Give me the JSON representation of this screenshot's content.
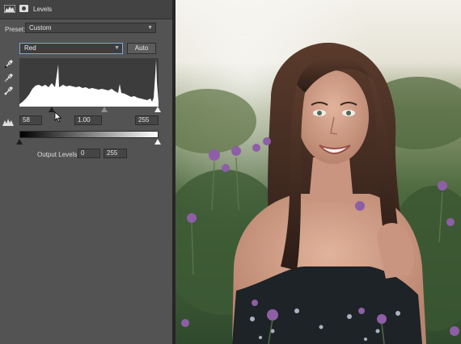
{
  "panel": {
    "title": "Levels",
    "preset_label": "Preset:",
    "preset_value": "Custom",
    "channel_value": "Red",
    "auto_label": "Auto",
    "input_levels": {
      "black": "58",
      "gamma": "1.00",
      "white": "255"
    },
    "output_label": "Output Levels:",
    "output_levels": {
      "black": "0",
      "white": "255"
    },
    "icons": [
      "levels-adjustment-icon",
      "layer-mask-icon",
      "black-point-eyedropper-icon",
      "gray-point-eyedropper-icon",
      "white-point-eyedropper-icon",
      "clipping-warning-icon",
      "mouse-cursor-icon"
    ]
  },
  "colors": {
    "panel_bg": "#535353",
    "header_bg": "#434343",
    "field_bg": "#454545",
    "histogram_fill": "#ffffff",
    "histogram_bg": "#3c3c3c",
    "focus_border": "#7fa9d8"
  },
  "photo": {
    "subject": "portrait-photo"
  }
}
